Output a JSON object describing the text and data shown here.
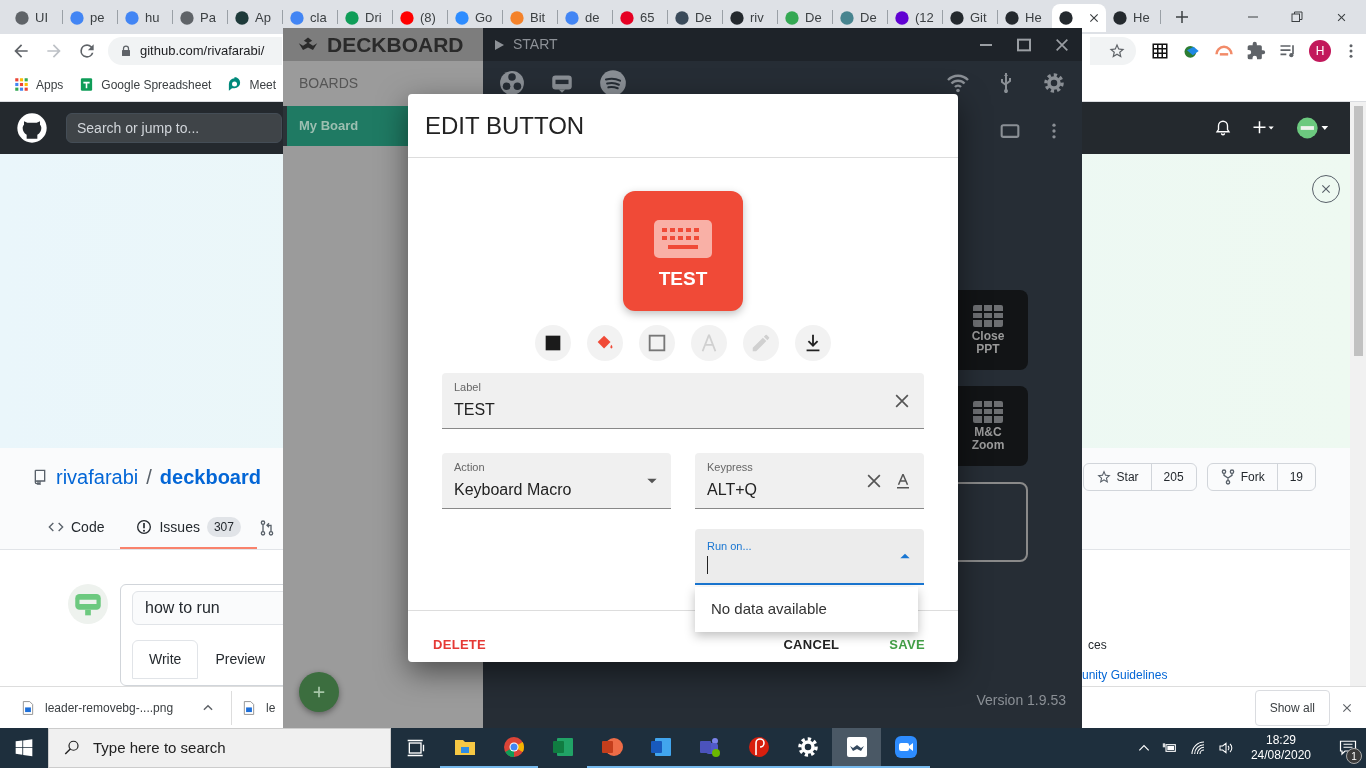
{
  "browser": {
    "tabs": [
      {
        "label": "UI",
        "selected": false
      },
      {
        "label": "pe",
        "selected": false
      },
      {
        "label": "hu",
        "selected": false
      },
      {
        "label": "Pa",
        "selected": false
      },
      {
        "label": "Ap",
        "selected": false
      },
      {
        "label": "cla",
        "selected": false
      },
      {
        "label": "Dri",
        "selected": false
      },
      {
        "label": "(8)",
        "selected": false
      },
      {
        "label": "Go",
        "selected": false
      },
      {
        "label": "Bit",
        "selected": false
      },
      {
        "label": "de",
        "selected": false
      },
      {
        "label": "65",
        "selected": false
      },
      {
        "label": "De",
        "selected": false
      },
      {
        "label": "riv",
        "selected": false
      },
      {
        "label": "De",
        "selected": false
      },
      {
        "label": "De",
        "selected": false
      },
      {
        "label": "(12",
        "selected": false
      },
      {
        "label": "Git",
        "selected": false
      },
      {
        "label": "He",
        "selected": false
      },
      {
        "selected": true
      },
      {
        "label": "He",
        "selected": false
      }
    ],
    "address": "github.com/rivafarabi/",
    "profile_initial": "H",
    "bookmarks": [
      {
        "label": "Apps"
      },
      {
        "label": "Google Spreadsheet"
      },
      {
        "label": "Meet"
      }
    ]
  },
  "github": {
    "search": {
      "placeholder": "Search or jump to..."
    },
    "owner": "rivafarabi",
    "separator": "/",
    "repo": "deckboard",
    "star": {
      "label": "Star",
      "count": "205"
    },
    "fork": {
      "label": "Fork",
      "count": "19"
    },
    "tabs": [
      {
        "label": "Code",
        "selected": false
      },
      {
        "label": "Issues",
        "count": "307",
        "selected": true
      }
    ],
    "issue_title": "how to run",
    "editor_tabs": [
      {
        "label": "Write",
        "selected": true
      },
      {
        "label": "Preview",
        "selected": false
      }
    ],
    "sidebar": [
      {
        "text": "ces",
        "kind": "text"
      },
      {
        "text": "unity Guidelines",
        "kind": "link"
      }
    ]
  },
  "deckboard": {
    "app_name": "DECKBOARD",
    "start": "START",
    "boards_heading": "BOARDS",
    "boards": [
      {
        "label": "My Board",
        "selected": true
      }
    ],
    "deck_buttons": [
      {
        "label": "Close PPT",
        "kind": "grid"
      },
      {
        "label": "M&C Zoom",
        "kind": "grid"
      },
      {
        "kind": "empty"
      }
    ],
    "version": "Version 1.9.53"
  },
  "dialog": {
    "title": "EDIT BUTTON",
    "preview": {
      "label": "TEST"
    },
    "tools": [
      {
        "disabled": false
      },
      {
        "disabled": false
      },
      {
        "disabled": false
      },
      {
        "disabled": true
      },
      {
        "disabled": true
      },
      {
        "disabled": false
      }
    ],
    "fields": {
      "label": {
        "label": "Label",
        "value": "TEST"
      },
      "action": {
        "label": "Action",
        "value": "Keyboard Macro"
      },
      "keypress": {
        "label": "Keypress",
        "value": "ALT+Q"
      },
      "run_on": {
        "label": "Run on...",
        "focused": true
      }
    },
    "dropdown": {
      "message": "No data available"
    },
    "buttons": [
      {
        "label": "DELETE",
        "kind": "danger"
      },
      {
        "label": "CANCEL",
        "kind": "plain"
      },
      {
        "label": "SAVE",
        "kind": "success"
      }
    ]
  },
  "downloads": {
    "items": [
      {
        "name": "leader-removebg-....png"
      },
      {
        "name": "le"
      }
    ],
    "show_all": "Show all"
  },
  "taskbar": {
    "search": {
      "placeholder": "Type here to search"
    },
    "apps": [
      {
        "running": true,
        "selected": false
      },
      {
        "running": true,
        "selected": false
      },
      {
        "running": false,
        "selected": false
      },
      {
        "running": true,
        "selected": false
      },
      {
        "running": true,
        "selected": false
      },
      {
        "running": true,
        "selected": false
      },
      {
        "running": true,
        "selected": false
      },
      {
        "running": true,
        "selected": false
      },
      {
        "running": true,
        "selected": true
      },
      {
        "running": true,
        "selected": false
      }
    ],
    "time": "18:29",
    "date": "24/08/2020",
    "notifications": "1"
  }
}
